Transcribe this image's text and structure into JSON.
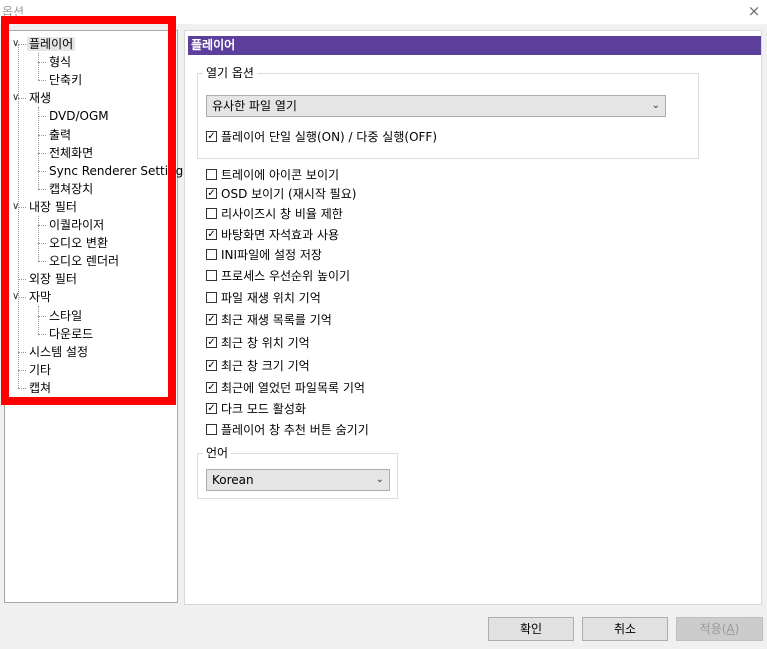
{
  "window": {
    "title": "옵션",
    "close_glyph": "×"
  },
  "tree": [
    {
      "label": "플레이어",
      "level": 0,
      "expanded": true,
      "selected": true
    },
    {
      "label": "형식",
      "level": 1
    },
    {
      "label": "단축키",
      "level": 1
    },
    {
      "label": "재생",
      "level": 0,
      "expanded": true
    },
    {
      "label": "DVD/OGM",
      "level": 1
    },
    {
      "label": "출력",
      "level": 1
    },
    {
      "label": "전체화면",
      "level": 1
    },
    {
      "label": "Sync Renderer Settings",
      "level": 1
    },
    {
      "label": "캡쳐장치",
      "level": 1
    },
    {
      "label": "내장 필터",
      "level": 0,
      "expanded": true
    },
    {
      "label": "이퀄라이저",
      "level": 1
    },
    {
      "label": "오디오 변환",
      "level": 1
    },
    {
      "label": "오디오 렌더러",
      "level": 1
    },
    {
      "label": "외장 필터",
      "level": 0
    },
    {
      "label": "자막",
      "level": 0,
      "expanded": true
    },
    {
      "label": "스타일",
      "level": 1
    },
    {
      "label": "다운로드",
      "level": 1
    },
    {
      "label": "시스템 설정",
      "level": 0
    },
    {
      "label": "기타",
      "level": 0
    },
    {
      "label": "캡쳐",
      "level": 0
    }
  ],
  "section": {
    "title": "플레이어"
  },
  "open_options": {
    "legend": "열기 옵션",
    "mode_select": "유사한 파일 열기",
    "single_instance": {
      "label": "플레이어 단일 실행(ON) / 다중 실행(OFF)",
      "checked": true
    }
  },
  "options": [
    {
      "label": "트레이에 아이콘 보이기",
      "checked": false
    },
    {
      "label": "OSD 보이기 (재시작 필요)",
      "checked": true
    },
    {
      "label": "리사이즈시 창 비율 제한",
      "checked": false
    },
    {
      "label": "바탕화면 자석효과 사용",
      "checked": true
    },
    {
      "label": "INI파일에 설정 저장",
      "checked": false
    },
    {
      "label": "프로세스 우선순위 높이기",
      "checked": false
    },
    {
      "label": "파일 재생 위치 기억",
      "checked": false
    },
    {
      "label": "최근 재생 목록를 기억",
      "checked": true
    },
    {
      "label": "최근 창 위치 기억",
      "checked": true
    },
    {
      "label": "최근 창 크기 기억",
      "checked": true
    },
    {
      "label": "최근에 열었던 파일목록 기억",
      "checked": true
    },
    {
      "label": "다크 모드 활성화",
      "checked": true
    },
    {
      "label": "플레이어 창 추천 버튼 숨기기",
      "checked": false
    }
  ],
  "language": {
    "legend": "언어",
    "value": "Korean"
  },
  "buttons": {
    "ok": "확인",
    "cancel": "취소",
    "apply_prefix": "적용(",
    "apply_key": "A",
    "apply_suffix": ")"
  },
  "colors": {
    "header_bg": "#5b3f9b",
    "highlight_border": "#ff0000"
  }
}
